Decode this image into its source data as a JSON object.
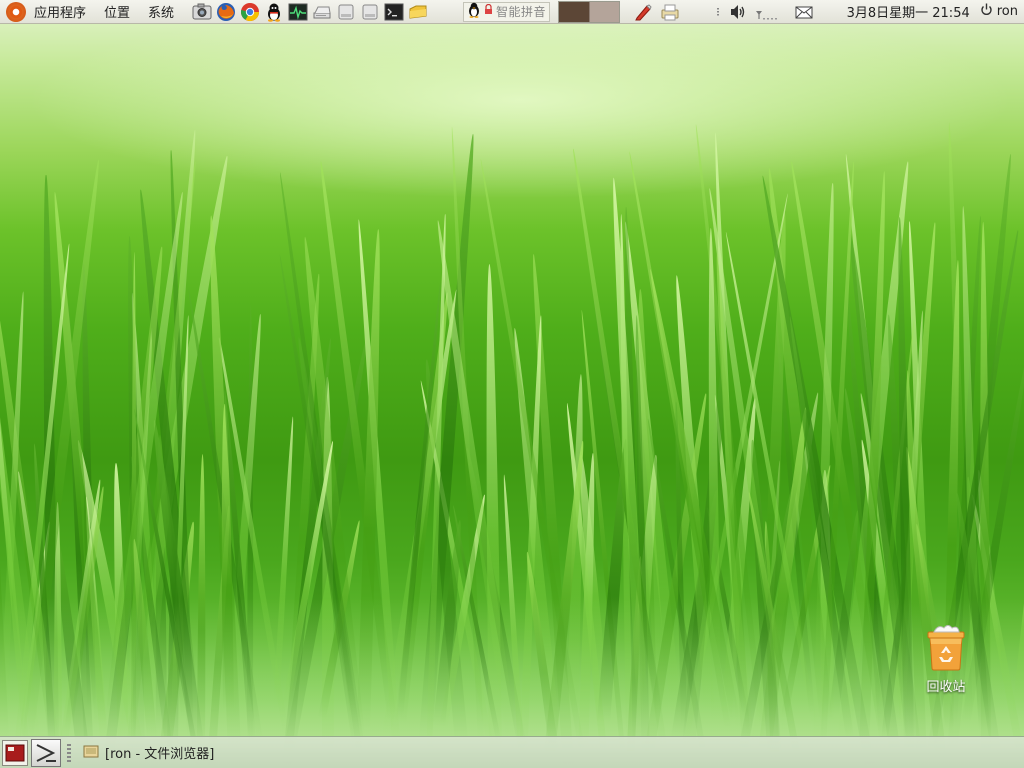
{
  "top_panel": {
    "menus": [
      {
        "label": "应用程序"
      },
      {
        "label": "位置"
      },
      {
        "label": "系统"
      }
    ],
    "launchers": [
      {
        "name": "screenshot-icon"
      },
      {
        "name": "firefox-icon"
      },
      {
        "name": "chrome-icon"
      },
      {
        "name": "qq-icon"
      },
      {
        "name": "system-monitor-icon"
      },
      {
        "name": "scanner-icon"
      },
      {
        "name": "drive-icon"
      },
      {
        "name": "drive-icon"
      },
      {
        "name": "terminal-icon"
      },
      {
        "name": "folder-icon"
      }
    ],
    "ime": {
      "label": "智能拼音"
    },
    "clock": "3月8日星期一 21:54",
    "user": "ron"
  },
  "desktop": {
    "icons": [
      {
        "label": "回收站",
        "icon": "trash-icon"
      }
    ]
  },
  "bottom_panel": {
    "tasks": [
      {
        "label": "[ron - 文件浏览器]"
      }
    ]
  }
}
